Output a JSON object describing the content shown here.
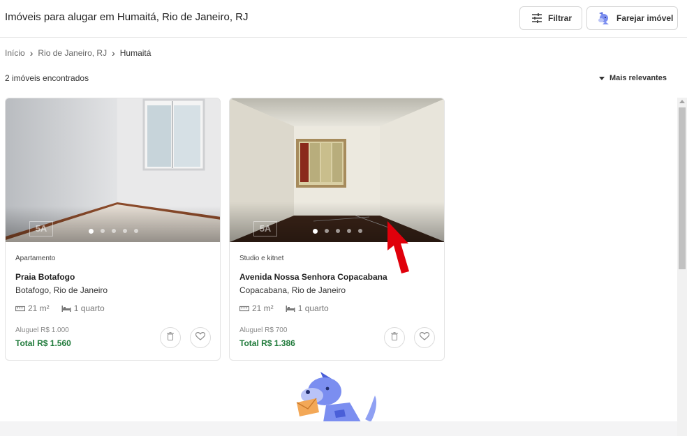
{
  "header": {
    "title": "Imóveis para alugar em Humaitá, Rio de Janeiro, RJ",
    "filter_label": "Filtrar",
    "farejar_label": "Farejar imóvel"
  },
  "breadcrumb": {
    "items": [
      "Início",
      "Rio de Janeiro, RJ",
      "Humaitá"
    ],
    "separator": "›"
  },
  "results": {
    "count_text": "2 imóveis encontrados",
    "sort_label": "Mais relevantes"
  },
  "listings": [
    {
      "type": "Apartamento",
      "street": "Praia Botafogo",
      "neighborhood": "Botafogo, Rio de Janeiro",
      "area": "21 m²",
      "rooms": "1 quarto",
      "rent": "Aluguel R$ 1.000",
      "total": "Total R$ 1.560",
      "photo_count": 5,
      "active_photo": 1,
      "watermark": "5A"
    },
    {
      "type": "Studio e kitnet",
      "street": "Avenida Nossa Senhora Copacabana",
      "neighborhood": "Copacabana, Rio de Janeiro",
      "area": "21 m²",
      "rooms": "1 quarto",
      "rent": "Aluguel R$ 700",
      "total": "Total R$ 1.386",
      "photo_count": 5,
      "active_photo": 1,
      "watermark": "5A"
    }
  ],
  "icons": {
    "filter": "sliders-icon",
    "farejar": "dog-icon",
    "area": "ruler-icon",
    "rooms": "bed-icon",
    "delete": "trash-icon",
    "favorite": "heart-icon"
  },
  "colors": {
    "total_price": "#1f7a3a",
    "mascot": "#7b8ef0",
    "pointer": "#e0000b"
  }
}
